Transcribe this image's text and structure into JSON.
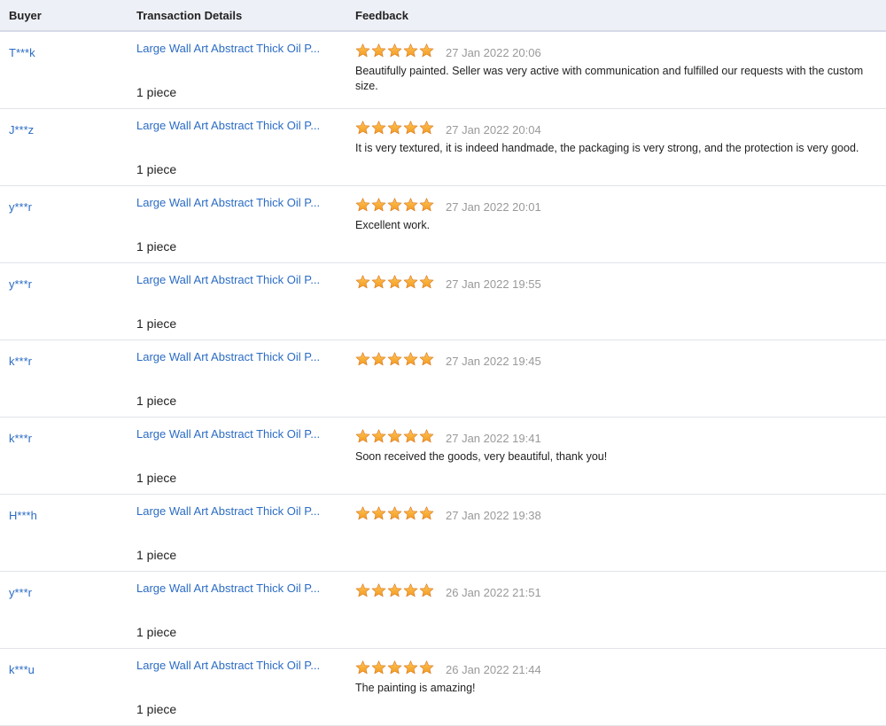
{
  "header": {
    "buyer": "Buyer",
    "transaction_details": "Transaction Details",
    "feedback": "Feedback"
  },
  "colors": {
    "link": "#2b6cc4",
    "star_fill": "#f39a1e",
    "header_bg": "#eef0f7",
    "date_gray": "#999999"
  },
  "star_icon": "star-icon",
  "rows": [
    {
      "buyer": "T***k",
      "product": "Large Wall Art Abstract Thick Oil P...",
      "quantity": "1 piece",
      "rating": 5,
      "date": "27 Jan 2022 20:06",
      "comment": "Beautifully painted. Seller was very active with communication and fulfilled our requests with the custom size."
    },
    {
      "buyer": "J***z",
      "product": "Large Wall Art Abstract Thick Oil P...",
      "quantity": "1 piece",
      "rating": 5,
      "date": "27 Jan 2022 20:04",
      "comment": "It is very textured, it is indeed handmade, the packaging is very strong, and the protection is very good."
    },
    {
      "buyer": "y***r",
      "product": "Large Wall Art Abstract Thick Oil P...",
      "quantity": "1 piece",
      "rating": 5,
      "date": "27 Jan 2022 20:01",
      "comment": "Excellent work."
    },
    {
      "buyer": "y***r",
      "product": "Large Wall Art Abstract Thick Oil P...",
      "quantity": "1 piece",
      "rating": 5,
      "date": "27 Jan 2022 19:55",
      "comment": ""
    },
    {
      "buyer": "k***r",
      "product": "Large Wall Art Abstract Thick Oil P...",
      "quantity": "1 piece",
      "rating": 5,
      "date": "27 Jan 2022 19:45",
      "comment": ""
    },
    {
      "buyer": "k***r",
      "product": "Large Wall Art Abstract Thick Oil P...",
      "quantity": "1 piece",
      "rating": 5,
      "date": "27 Jan 2022 19:41",
      "comment": "Soon received the goods, very beautiful, thank you!"
    },
    {
      "buyer": "H***h",
      "product": "Large Wall Art Abstract Thick Oil P...",
      "quantity": "1 piece",
      "rating": 5,
      "date": "27 Jan 2022 19:38",
      "comment": ""
    },
    {
      "buyer": "y***r",
      "product": "Large Wall Art Abstract Thick Oil P...",
      "quantity": "1 piece",
      "rating": 5,
      "date": "26 Jan 2022 21:51",
      "comment": ""
    },
    {
      "buyer": "k***u",
      "product": "Large Wall Art Abstract Thick Oil P...",
      "quantity": "1 piece",
      "rating": 5,
      "date": "26 Jan 2022 21:44",
      "comment": "The painting is amazing!"
    }
  ]
}
